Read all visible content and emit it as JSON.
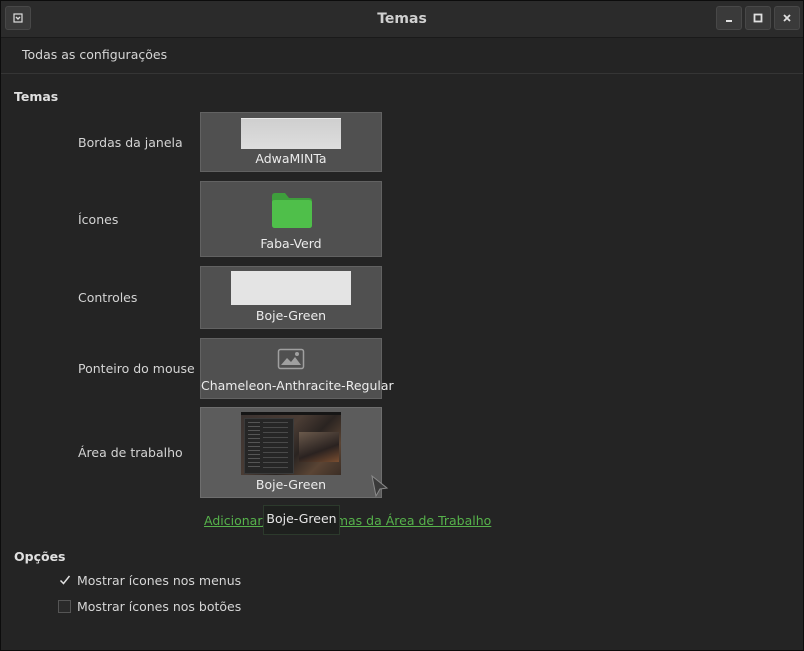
{
  "window": {
    "title": "Temas"
  },
  "menubar": {
    "all_settings": "Todas as configurações"
  },
  "themes_section": {
    "title": "Temas",
    "rows": [
      {
        "label": "Bordas da janela",
        "value": "AdwaMINTa"
      },
      {
        "label": "Ícones",
        "value": "Faba-Verd"
      },
      {
        "label": "Controles",
        "value": "Boje-Green"
      },
      {
        "label": "Ponteiro do mouse",
        "value": "Chameleon-Anthracite-Regular"
      },
      {
        "label": "Área de trabalho",
        "value": "Boje-Green"
      }
    ],
    "add_link": "Adicionar/remover temas da Área de Trabalho",
    "tooltip": "Boje-Green"
  },
  "options_section": {
    "title": "Opções",
    "options": [
      {
        "label": "Mostrar ícones nos menus",
        "checked": true
      },
      {
        "label": "Mostrar ícones nos botões",
        "checked": false
      }
    ]
  },
  "colors": {
    "accent": "#56b24b",
    "folder_green": "#4caf50"
  },
  "icons": [
    "window-menu-icon",
    "minimize-icon",
    "maximize-icon",
    "close-icon",
    "folder-icon",
    "image-placeholder-icon",
    "checkmark-icon",
    "mouse-pointer-icon"
  ]
}
